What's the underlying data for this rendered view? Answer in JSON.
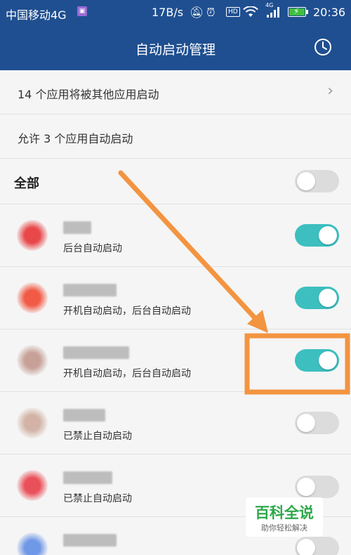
{
  "status_bar": {
    "carrier": "中国移动4G",
    "speed": "17B/s",
    "network": "4G",
    "hd": "HD",
    "time": "20:36"
  },
  "header": {
    "title": "自动启动管理",
    "clock_icon": "clock-icon"
  },
  "summary": {
    "launched_by_others": "14 个应用将被其他应用启动",
    "allowed_count": "允许 3 个应用自动启动"
  },
  "all_section": {
    "label": "全部",
    "toggle_on": false
  },
  "apps": [
    {
      "status": "后台自动启动",
      "enabled": true,
      "icon_color": "#e8484a"
    },
    {
      "status": "开机自动启动，后台自动启动",
      "enabled": true,
      "icon_color": "#f15a45"
    },
    {
      "status": "开机自动启动，后台自动启动",
      "enabled": true,
      "icon_color": "#c7a197"
    },
    {
      "status": "已禁止自动启动",
      "enabled": false,
      "icon_color": "#d2b3a6"
    },
    {
      "status": "已禁止自动启动",
      "enabled": false,
      "icon_color": "#e9505a"
    },
    {
      "status": "",
      "enabled": false,
      "icon_color": "#6f98e6"
    }
  ],
  "colors": {
    "header": "#1f4f90",
    "toggle_on": "#3dbfbf",
    "toggle_off": "#dcdcdc",
    "annotation": "#f39440"
  },
  "watermark": {
    "title": "百科全说",
    "subtitle": "助你轻松解决"
  }
}
